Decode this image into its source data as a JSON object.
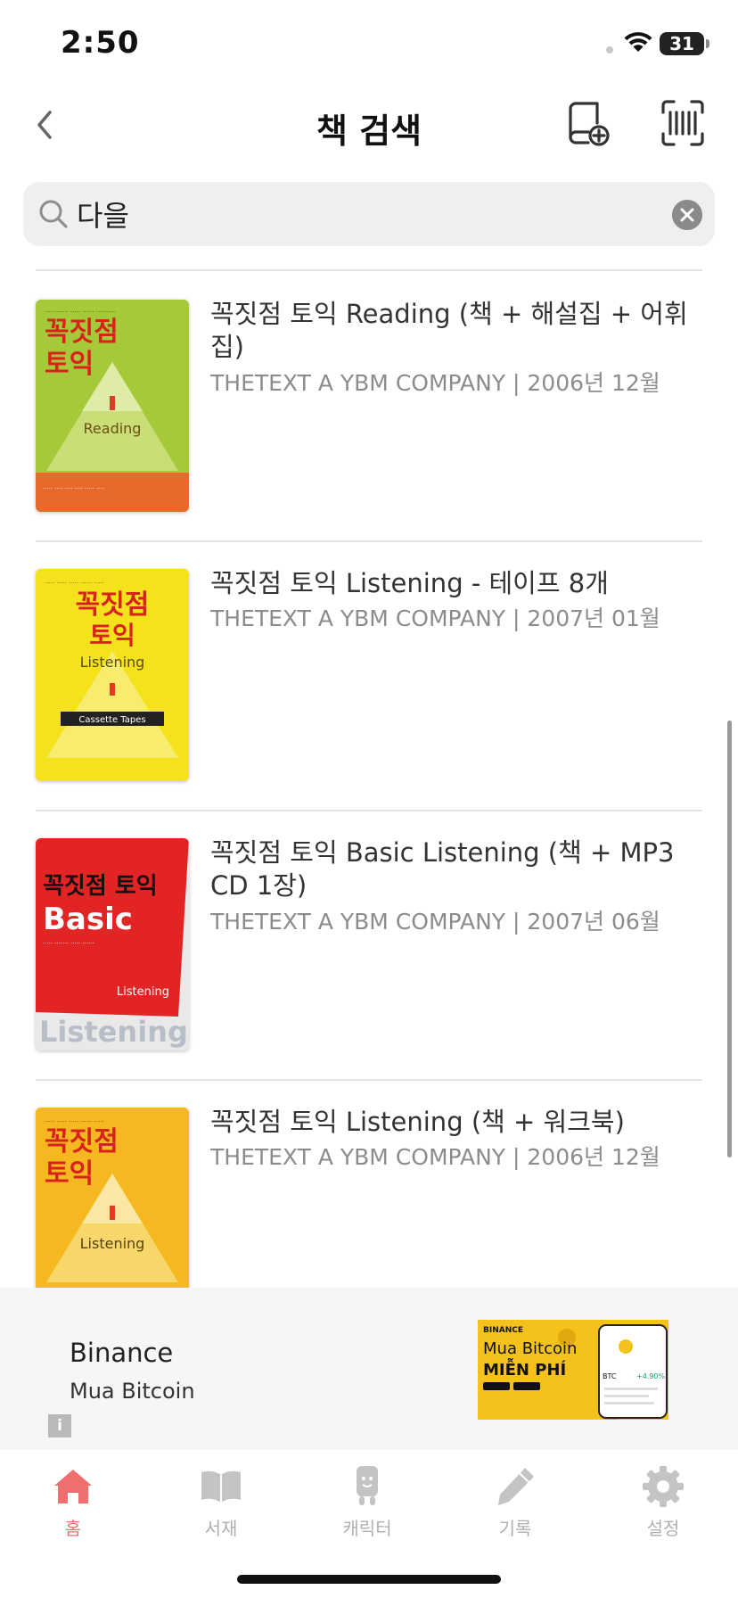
{
  "status_bar": {
    "time": "2:50",
    "battery_level": "31"
  },
  "nav": {
    "title": "책 검색",
    "back_icon": "chevron-left-icon",
    "add_book_icon": "book-add-icon",
    "barcode_icon": "barcode-scan-icon"
  },
  "search": {
    "query": "다을",
    "placeholder": "",
    "clear_icon": "clear-x-icon"
  },
  "results": [
    {
      "title": "꼭짓점 토익 Reading (책 + 해설집 + 어휘집)",
      "meta": "THETEXT A YBM COMPANY | 2006년 12월",
      "cover": {
        "top_text": "꼭짓점",
        "mid_text": "토익",
        "label": "Reading",
        "bg": "#a6c93a",
        "band": "#e86a2a"
      }
    },
    {
      "title": "꼭짓점 토익 Listening - 테이프 8개",
      "meta": "THETEXT A YBM COMPANY | 2007년 01월",
      "cover": {
        "top_text": "꼭짓점",
        "mid_text": "토익",
        "label": "Listening",
        "sub_label": "Cassette Tapes",
        "bg": "#f4e21c"
      }
    },
    {
      "title": "꼭짓점 토익 Basic Listening (책 + MP3 CD 1장)",
      "meta": "THETEXT A YBM COMPANY | 2007년 06월",
      "cover": {
        "top_text": "꼭짓점 토익",
        "mid_text": "Basic",
        "label": "Listening",
        "footer_text": "Listening",
        "bg": "#e32424"
      }
    },
    {
      "title": "꼭짓점 토익 Listening (책 + 워크북)",
      "meta": "THETEXT A YBM COMPANY | 2006년 12월",
      "cover": {
        "top_text": "꼭짓점",
        "mid_text": "토익",
        "label": "Listening",
        "bg": "#f5b820",
        "band": "#1a9ad6"
      }
    }
  ],
  "ad": {
    "title": "Binance",
    "subtitle": "Mua Bitcoin",
    "info_label": "i",
    "image": {
      "brand": "BINANCE",
      "headline_1": "Mua Bitcoin",
      "headline_2": "MIỄN PHÍ",
      "ticker": "BTC",
      "change": "+4.90%"
    }
  },
  "tabs": [
    {
      "label": "홈",
      "icon": "home-icon",
      "active": true
    },
    {
      "label": "서재",
      "icon": "open-book-icon",
      "active": false
    },
    {
      "label": "캐릭터",
      "icon": "character-icon",
      "active": false
    },
    {
      "label": "기록",
      "icon": "pencil-icon",
      "active": false
    },
    {
      "label": "설정",
      "icon": "gear-icon",
      "active": false
    }
  ],
  "colors": {
    "accent": "#ef6f6f",
    "inactive": "#b0b0b0",
    "divider": "#e3e3e3"
  }
}
